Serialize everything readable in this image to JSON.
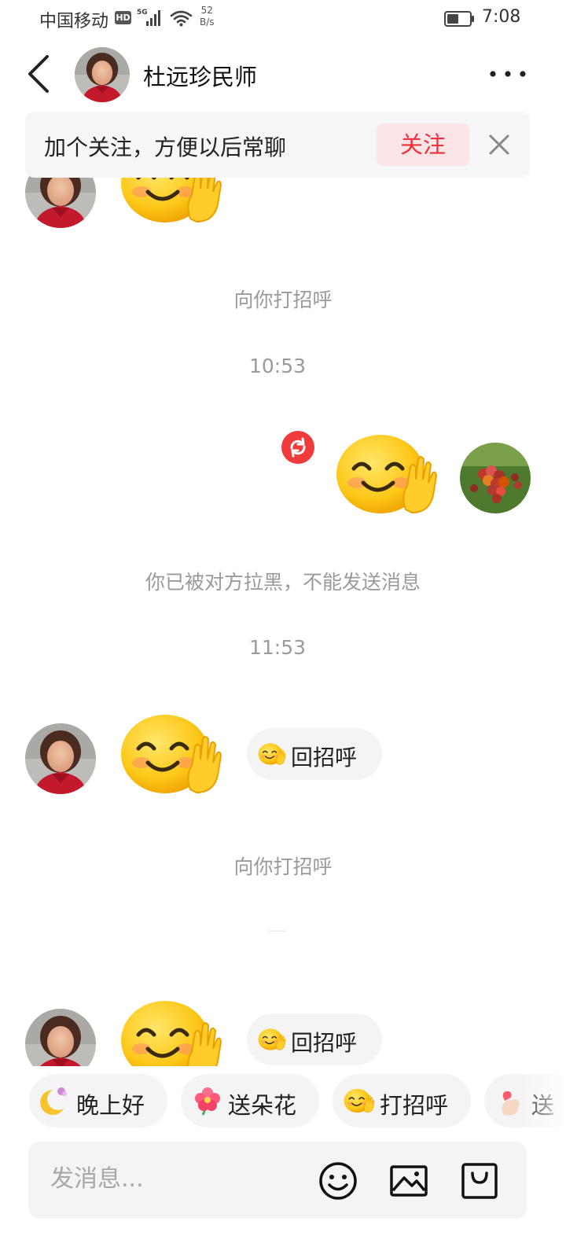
{
  "status_bar": {
    "carrier": "中国移动",
    "hd": "HD",
    "network": "5G",
    "speed_value": "52",
    "speed_unit": "B/s",
    "time": "7:08"
  },
  "header": {
    "title": "杜远珍民师"
  },
  "follow_banner": {
    "text": "加个关注，方便以后常聊",
    "button_label": "关注"
  },
  "messages": [
    {
      "type": "system",
      "text": "向你打招呼"
    },
    {
      "type": "time",
      "text": "10:53"
    },
    {
      "type": "system",
      "text": "你已被对方拉黑，不能发送消息"
    },
    {
      "type": "time",
      "text": "11:53"
    },
    {
      "type": "system",
      "text": "向你打招呼"
    }
  ],
  "reply_chip_label": "回招呼",
  "quick_replies": [
    {
      "label": "晚上好",
      "icon": "moon-icon"
    },
    {
      "label": "送朵花",
      "icon": "flower-icon"
    },
    {
      "label": "打招呼",
      "icon": "wave-emoji-icon"
    },
    {
      "label": "送",
      "icon": "finger-heart-icon"
    }
  ],
  "input": {
    "placeholder": "发消息..."
  },
  "colors": {
    "accent_red": "#f0303c",
    "follow_bg": "#fde4e6",
    "system_text": "#9a9a9a"
  }
}
